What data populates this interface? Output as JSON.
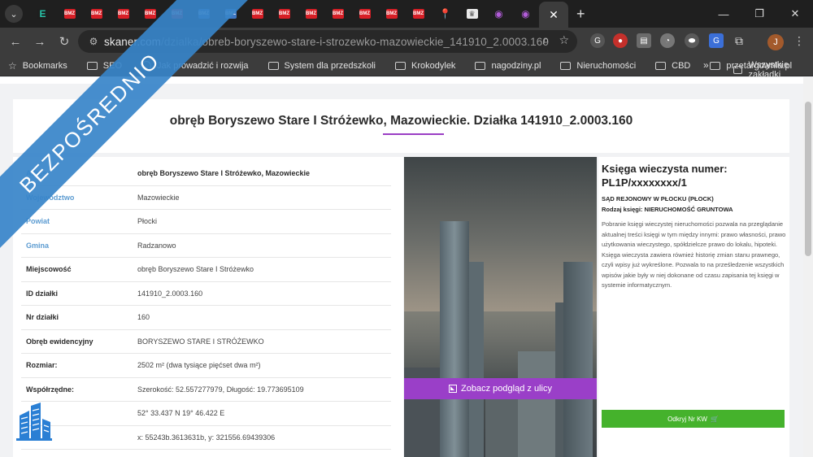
{
  "browser": {
    "tabs": [
      "E",
      "BMZ",
      "BMZ",
      "BMZ",
      "BMZ",
      "BMZ",
      "BMZ",
      "BMZ",
      "BMZ",
      "BMZ",
      "BMZ",
      "BMZ",
      "BMZ",
      "BMZ",
      "BMZ",
      "BMZ",
      "BMZ"
    ],
    "tab_icons": [
      "e",
      "bmz",
      "bmz",
      "bmz",
      "bmz",
      "bmz",
      "blue",
      "blue",
      "bmz",
      "bmz",
      "bmz",
      "bmz",
      "bmz",
      "bmz",
      "bmz",
      "pin",
      "eagle",
      "wave",
      "wave"
    ],
    "active_tab_close": "✕",
    "new_tab": "+",
    "url_domain": "skaner.com",
    "url_path": "/dzialka/obreb-boryszewo-stare-i-strozewko-mazowieckie_141910_2.0003.160",
    "profile_initial": "J"
  },
  "bookmarks": {
    "items": [
      {
        "label": "Bookmarks",
        "icon": "star-icon"
      },
      {
        "label": "SEO",
        "icon": "folder-icon"
      },
      {
        "label": "Jak prowadzić i rozwija",
        "icon": "globe-icon"
      },
      {
        "label": "System dla przedszkoli",
        "icon": "folder-icon"
      },
      {
        "label": "Krokodylek",
        "icon": "folder-icon"
      },
      {
        "label": "nagodziny.pl",
        "icon": "folder-icon"
      },
      {
        "label": "Nieruchomości",
        "icon": "folder-icon"
      },
      {
        "label": "CBD",
        "icon": "folder-icon"
      },
      {
        "label": "przetargownia.pl",
        "icon": "folder-icon"
      }
    ],
    "more": "»",
    "all": "Wszystkie zakładki"
  },
  "page": {
    "title": "obręb Boryszewo Stare I Stróżewko, Mazowieckie. Działka 141910_2.0003.160",
    "rows": [
      {
        "key": "Adres",
        "value": "obręb Boryszewo Stare I Stróżewko, Mazowieckie",
        "bold": true,
        "hl": true
      },
      {
        "key": "Województwo",
        "value": "Mazowieckie",
        "hl": true
      },
      {
        "key": "Powiat",
        "value": "Płocki",
        "hl": true
      },
      {
        "key": "Gmina",
        "value": "Radzanowo",
        "hl": true
      },
      {
        "key": "Miejscowość",
        "value": "obręb Boryszewo Stare I Stróżewko"
      },
      {
        "key": "ID działki",
        "value": "141910_2.0003.160"
      },
      {
        "key": "Nr działki",
        "value": "160"
      },
      {
        "key": "Obręb ewidencyjny",
        "value": "BORYSZEWO STARE I STRÓŻEWKO"
      },
      {
        "key": "Rozmiar:",
        "value": "2502 m² (dwa tysiące pięćset dwa m²)"
      },
      {
        "key": "Współrzędne:",
        "value": "Szerokość: 52.557277979, Długość: 19.773695109"
      },
      {
        "key": "",
        "value": "52° 33.437 N 19° 46.422 E"
      },
      {
        "key": "",
        "value": "x: 55243b.3613631b, y: 321556.69439306"
      }
    ],
    "street_view": "Zobacz podgląd z ulicy",
    "kw": {
      "heading": "Księga wieczysta numer: PL1P/xxxxxxxx/1",
      "court": "SĄD REJONOWY W PŁOCKU (PŁOCK)",
      "type": "Rodzaj księgi: NIERUCHOMOŚĆ GRUNTOWA",
      "description": "Pobranie księgi wieczystej nieruchomości pozwala na przeglądanie aktualnej treści księgi w tym między innymi: prawo własności, prawo użytkowania wieczystego, spółdzielcze prawo do lokalu, hipoteki. Księga wieczysta zawiera również historię zmian stanu prawnego, czyli wpisy już wykreślone. Pozwala to na prześledzenie wszystkich wpisów jakie były w niej dokonane od czasu zapisania tej księgi w systemie informatycznym.",
      "button": "Odkryj Nr KW",
      "button_icon": "🛒"
    }
  },
  "overlay": {
    "ribbon": "BEZPOŚREDNIO",
    "ribbon_color": "#3784c9"
  },
  "colors": {
    "accent": "#9b3ec4",
    "button_green": "#45b22c",
    "link_blue": "#5b9bd1"
  }
}
